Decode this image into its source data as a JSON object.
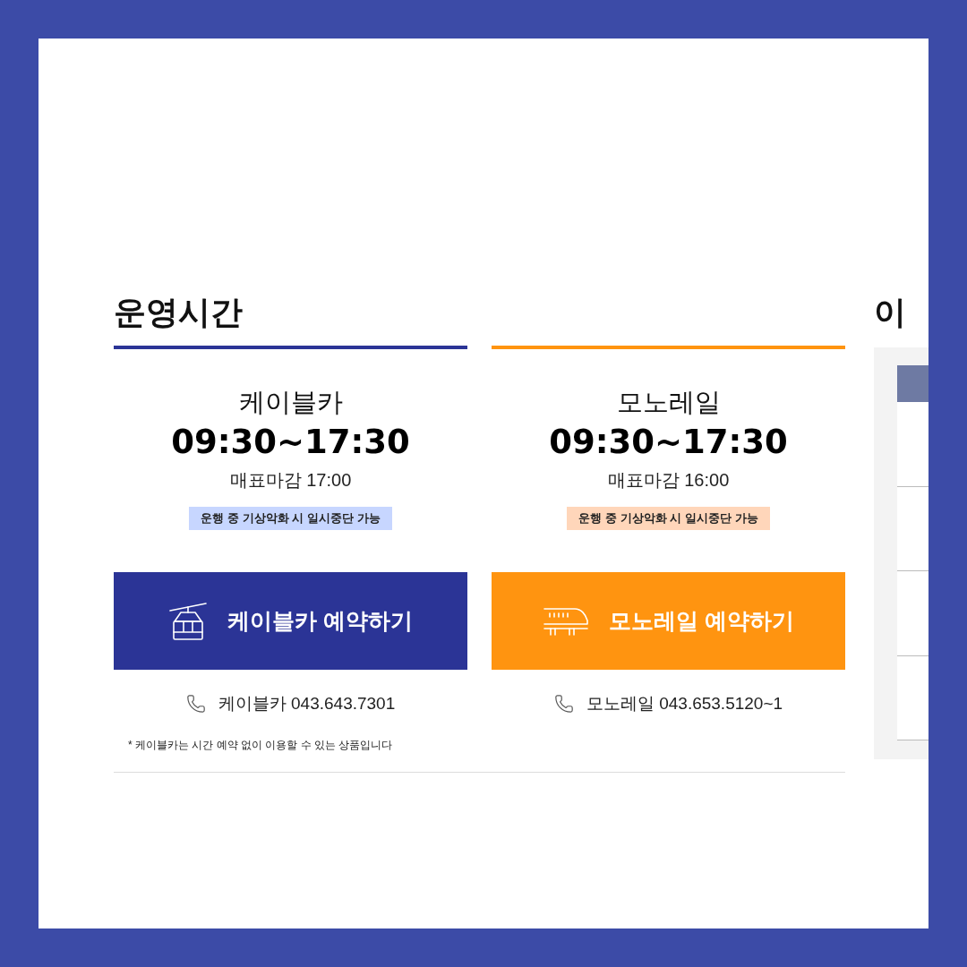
{
  "operating_hours": {
    "heading": "운영시간",
    "cards": [
      {
        "kind": "cablecar",
        "color": "#2b3496",
        "name": "케이블카",
        "hours": "09:30~17:30",
        "ticket_close": "매표마감 17:00",
        "notice": "운행 중 기상악화 시 일시중단 가능",
        "button": "케이블카 예약하기",
        "phone": "케이블카 043.643.7301"
      },
      {
        "kind": "monorail",
        "color": "#ff9410",
        "name": "모노레일",
        "hours": "09:30~17:30",
        "ticket_close": "매표마감 16:00",
        "notice": "운행 중 기상악화 시 일시중단 가능",
        "button": "모노레일 예약하기",
        "phone": "모노레일 043.653.5120~1"
      }
    ],
    "footnote": "* 케이블카는 시간 예약 없이 이용할 수 있는 상품입니다"
  },
  "usage_panel": {
    "heading": "이"
  }
}
